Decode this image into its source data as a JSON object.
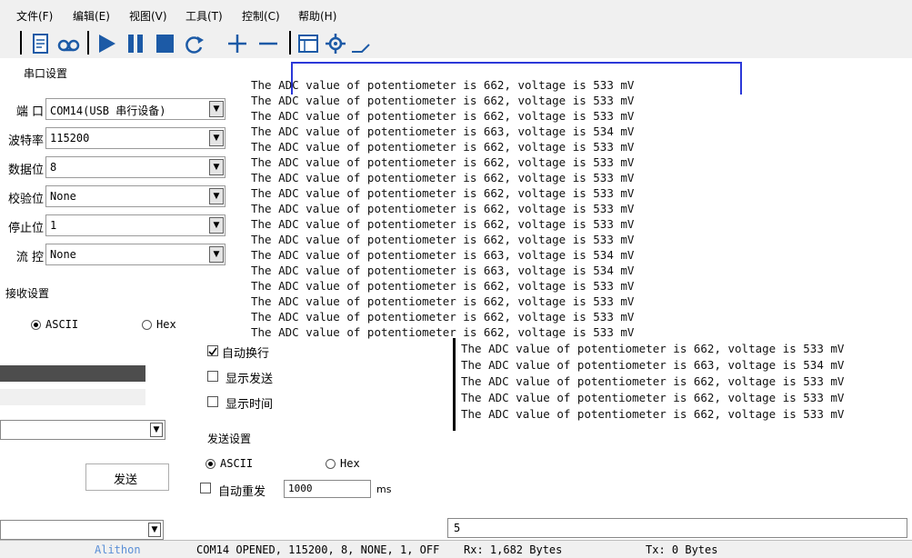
{
  "menu": {
    "items": [
      "文件(F)",
      "编辑(E)",
      "视图(V)",
      "工具(T)",
      "控制(C)",
      "帮助(H)"
    ]
  },
  "toolbar": {
    "icons": [
      "document-icon",
      "record-icon",
      "play-icon",
      "pause-icon",
      "stop-icon",
      "refresh-icon",
      "plus-icon",
      "minus-icon",
      "window-icon",
      "settings-icon"
    ]
  },
  "serial_settings": {
    "title": "串口设置",
    "fields": [
      {
        "label": "端  口",
        "value": "COM14(USB 串行设备)"
      },
      {
        "label": "波特率",
        "value": "115200"
      },
      {
        "label": "数据位",
        "value": "8"
      },
      {
        "label": "校验位",
        "value": "None"
      },
      {
        "label": "停止位",
        "value": "1"
      },
      {
        "label": "流  控",
        "value": "None"
      }
    ]
  },
  "receive_settings": {
    "title": "接收设置",
    "ascii": "ASCII",
    "hex": "Hex",
    "auto_wrap": "自动换行",
    "show_send": "显示发送",
    "show_time": "显示时间"
  },
  "send_settings": {
    "title": "发送设置",
    "ascii": "ASCII",
    "hex": "Hex",
    "auto_resend": "自动重发",
    "interval": "1000",
    "unit": "ms",
    "send_button": "发送"
  },
  "log": {
    "lines": [
      "The ADC value of potentiometer is 662, voltage is 533 mV",
      "The ADC value of potentiometer is 662, voltage is 533 mV",
      "The ADC value of potentiometer is 662, voltage is 533 mV",
      "The ADC value of potentiometer is 663, voltage is 534 mV",
      "The ADC value of potentiometer is 662, voltage is 533 mV",
      "The ADC value of potentiometer is 662, voltage is 533 mV",
      "The ADC value of potentiometer is 662, voltage is 533 mV",
      "The ADC value of potentiometer is 662, voltage is 533 mV",
      "The ADC value of potentiometer is 662, voltage is 533 mV",
      "The ADC value of potentiometer is 662, voltage is 533 mV",
      "The ADC value of potentiometer is 662, voltage is 533 mV",
      "The ADC value of potentiometer is 663, voltage is 534 mV",
      "The ADC value of potentiometer is 663, voltage is 534 mV",
      "The ADC value of potentiometer is 662, voltage is 533 mV",
      "The ADC value of potentiometer is 662, voltage is 533 mV",
      "The ADC value of potentiometer is 662, voltage is 533 mV",
      "The ADC value of potentiometer is 662, voltage is 533 mV"
    ],
    "lower_lines": [
      "The ADC value of potentiometer is 662, voltage is 533 mV",
      "The ADC value of potentiometer is 663, voltage is 534 mV",
      "The ADC value of potentiometer is 662, voltage is 533 mV",
      "The ADC value of potentiometer is 662, voltage is 533 mV",
      "The ADC value of potentiometer is 662, voltage is 533 mV"
    ]
  },
  "send_input": {
    "value": "5"
  },
  "status": {
    "brand": "Alithon",
    "port": "COM14 OPENED, 115200, 8, NONE, 1, OFF",
    "rx": "Rx: 1,682 Bytes",
    "tx": "Tx: 0 Bytes"
  }
}
